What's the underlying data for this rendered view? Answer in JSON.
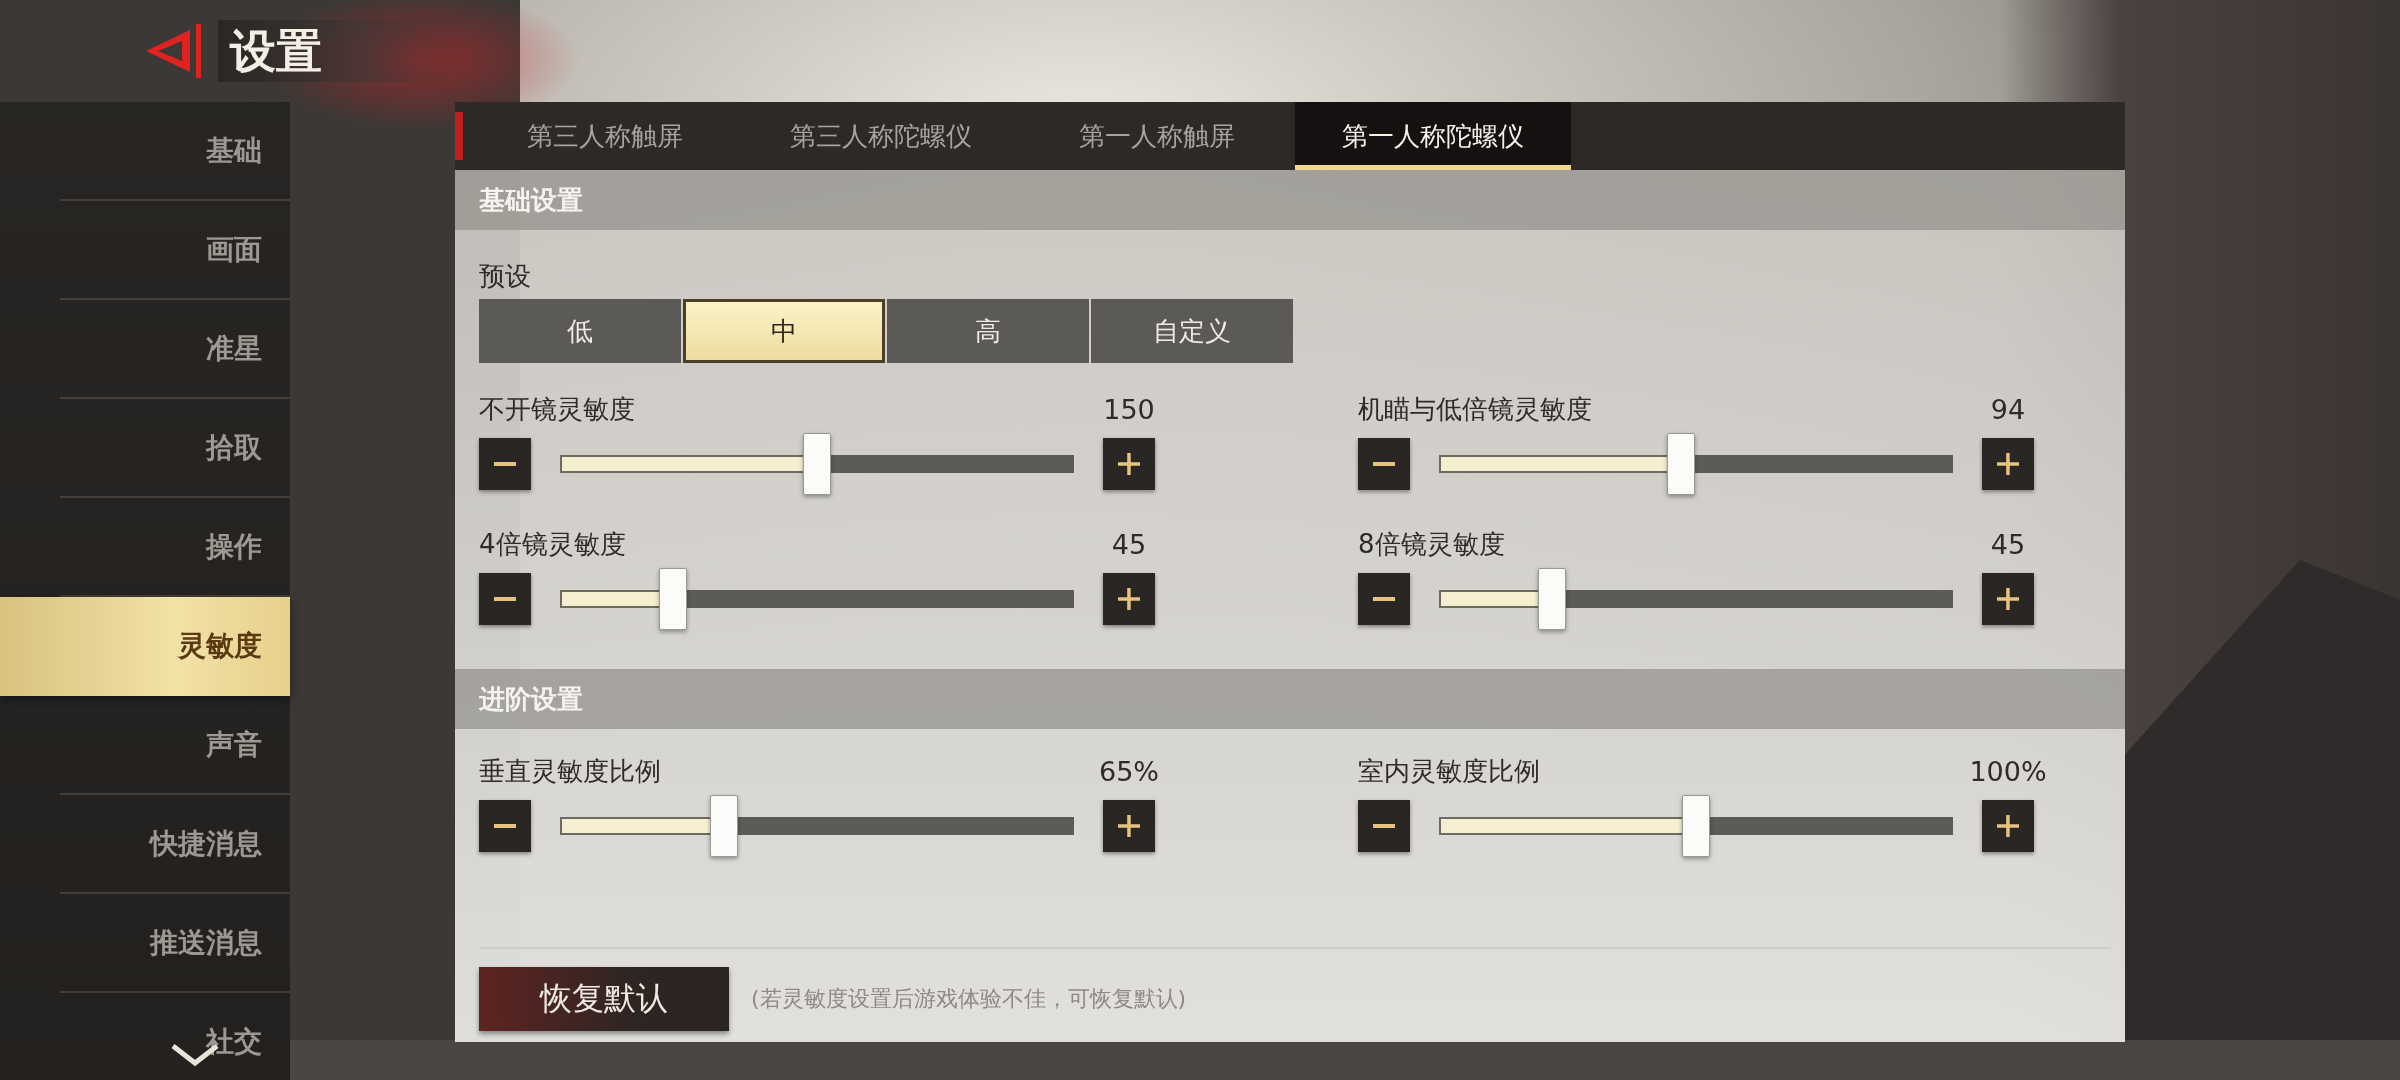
{
  "header": {
    "title": "设置"
  },
  "sidebar": {
    "items": [
      {
        "label": "基础",
        "selected": false
      },
      {
        "label": "画面",
        "selected": false
      },
      {
        "label": "准星",
        "selected": false
      },
      {
        "label": "拾取",
        "selected": false
      },
      {
        "label": "操作",
        "selected": false
      },
      {
        "label": "灵敏度",
        "selected": true
      },
      {
        "label": "声音",
        "selected": false
      },
      {
        "label": "快捷消息",
        "selected": false
      },
      {
        "label": "推送消息",
        "selected": false
      },
      {
        "label": "社交",
        "selected": false
      }
    ]
  },
  "tabs": [
    {
      "label": "第三人称触屏",
      "selected": false
    },
    {
      "label": "第三人称陀螺仪",
      "selected": false
    },
    {
      "label": "第一人称触屏",
      "selected": false
    },
    {
      "label": "第一人称陀螺仪",
      "selected": true
    }
  ],
  "sections": [
    {
      "title": "基础设置",
      "preset": {
        "label": "预设",
        "options": [
          {
            "label": "低",
            "selected": false
          },
          {
            "label": "中",
            "selected": true
          },
          {
            "label": "高",
            "selected": false
          },
          {
            "label": "自定义",
            "selected": false
          }
        ]
      },
      "sliders": [
        {
          "label": "不开镜灵敏度",
          "value": "150",
          "level": 0.5
        },
        {
          "label": "机瞄与低倍镜灵敏度",
          "value": "94",
          "level": 0.47
        },
        {
          "label": "4倍镜灵敏度",
          "value": "45",
          "level": 0.22
        },
        {
          "label": "8倍镜灵敏度",
          "value": "45",
          "level": 0.22
        }
      ]
    },
    {
      "title": "进阶设置",
      "sliders": [
        {
          "label": "垂直灵敏度比例",
          "value": "65%",
          "level": 0.32
        },
        {
          "label": "室内灵敏度比例",
          "value": "100%",
          "level": 0.5
        }
      ]
    }
  ],
  "footer": {
    "reset_button": "恢复默认",
    "hint": "(若灵敏度设置后游戏体验不佳，可恢复默认)"
  }
}
